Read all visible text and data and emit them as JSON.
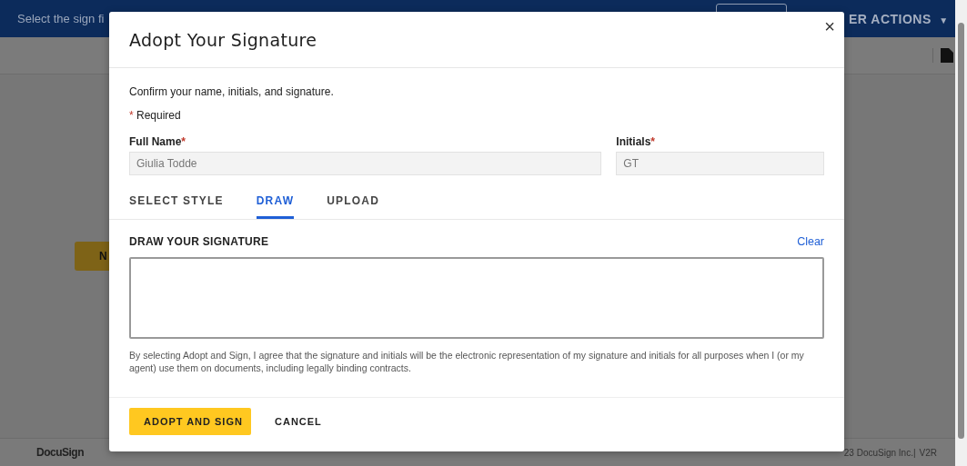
{
  "header": {
    "message": "Select the sign fi",
    "actions_menu": "ER ACTIONS",
    "actions_caret": "▼"
  },
  "background": {
    "button": "N"
  },
  "footer": {
    "logo": "DocuSign",
    "copyright": "23 DocuSign Inc.|",
    "version": "V2R"
  },
  "dialog": {
    "title": "Adopt Your Signature",
    "close": "×",
    "intro": "Confirm your name, initials, and signature.",
    "required_mark": "*",
    "required_label": "Required",
    "fields": [
      {
        "label": "Full Name",
        "required": true,
        "value": "Giulia Todde",
        "disabled": true
      },
      {
        "label": "Initials",
        "required": true,
        "value": "GT",
        "disabled": true
      }
    ],
    "tabs": [
      {
        "label": "SELECT STYLE",
        "selected": false
      },
      {
        "label": "DRAW",
        "selected": true
      },
      {
        "label": "UPLOAD",
        "selected": false
      }
    ],
    "draw_heading": "DRAW YOUR SIGNATURE",
    "clear": "Clear",
    "legal": "By selecting Adopt and Sign, I agree that the signature and initials will be the electronic representation of my signature and initials for all purposes when I (or my agent) use them on documents, including legally binding contracts.",
    "buttons": [
      {
        "label": "ADOPT AND SIGN",
        "kind": "primary"
      },
      {
        "label": "CANCEL",
        "kind": "secondary"
      }
    ]
  }
}
